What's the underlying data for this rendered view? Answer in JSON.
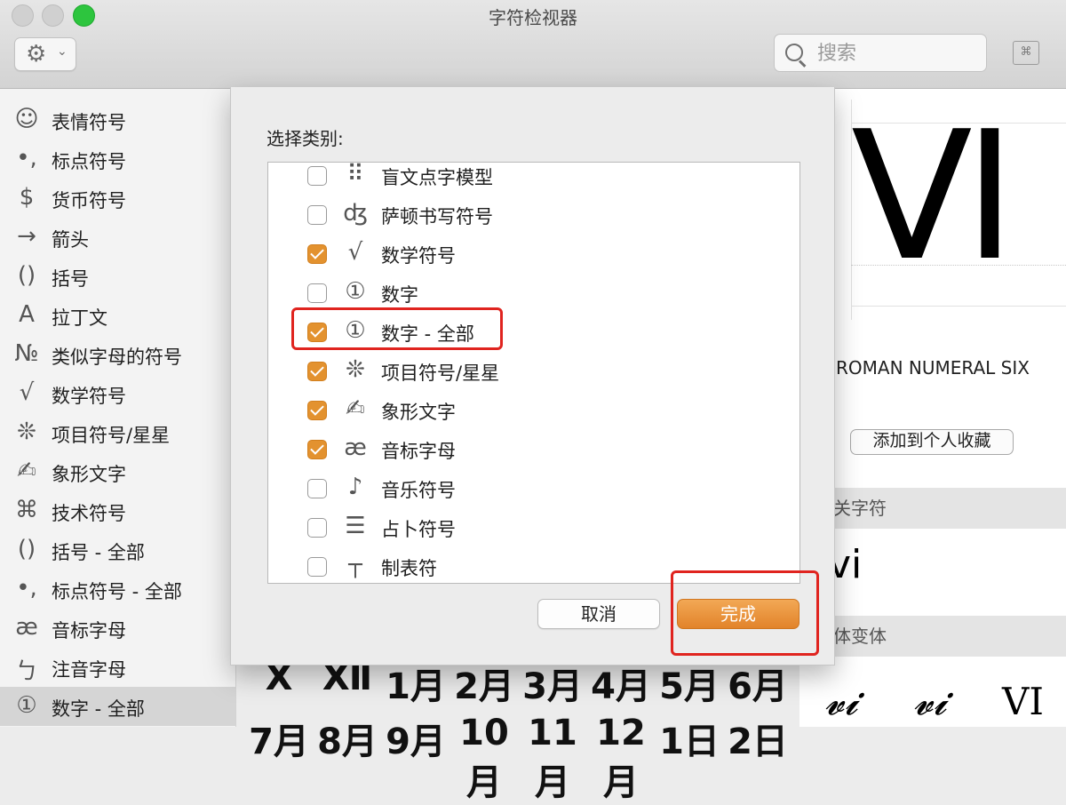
{
  "window": {
    "title": "字符检视器"
  },
  "toolbar": {
    "gear_icon": "⚙",
    "chevron": "⌄",
    "search_placeholder": "搜索",
    "keyboard_icon": "⌘"
  },
  "sidebar": {
    "items": [
      {
        "icon": "☺",
        "label": "表情符号"
      },
      {
        "icon": "•,",
        "label": "标点符号"
      },
      {
        "icon": "$",
        "label": "货币符号"
      },
      {
        "icon": "→",
        "label": "箭头"
      },
      {
        "icon": "()",
        "label": "括号"
      },
      {
        "icon": "A",
        "label": "拉丁文"
      },
      {
        "icon": "№",
        "label": "类似字母的符号"
      },
      {
        "icon": "√",
        "label": "数学符号"
      },
      {
        "icon": "❊",
        "label": "项目符号/星星"
      },
      {
        "icon": "✍",
        "label": "象形文字"
      },
      {
        "icon": "⌘",
        "label": "技术符号"
      },
      {
        "icon": "()",
        "label": "括号 - 全部"
      },
      {
        "icon": "•,",
        "label": "标点符号 - 全部"
      },
      {
        "icon": "æ",
        "label": "音标字母"
      },
      {
        "icon": "ㄅ",
        "label": "注音字母"
      },
      {
        "icon": "①",
        "label": "数字 - 全部"
      }
    ],
    "selected_index": 15
  },
  "dialog": {
    "label": "选择类别:",
    "categories": [
      {
        "icon": "⠿",
        "label": "盲文点字模型",
        "checked": false
      },
      {
        "icon": "ʤ",
        "label": "萨顿书写符号",
        "checked": false
      },
      {
        "icon": "√",
        "label": "数学符号",
        "checked": true
      },
      {
        "icon": "①",
        "label": "数字",
        "checked": false
      },
      {
        "icon": "①",
        "label": "数字 - 全部",
        "checked": true
      },
      {
        "icon": "❊",
        "label": "项目符号/星星",
        "checked": true
      },
      {
        "icon": "✍",
        "label": "象形文字",
        "checked": true
      },
      {
        "icon": "æ",
        "label": "音标字母",
        "checked": true
      },
      {
        "icon": "♪",
        "label": "音乐符号",
        "checked": false
      },
      {
        "icon": "☰",
        "label": "占卜符号",
        "checked": false
      },
      {
        "icon": "┬",
        "label": "制表符",
        "checked": false
      }
    ],
    "cancel_label": "取消",
    "done_label": "完成"
  },
  "detail": {
    "glyph": "VI",
    "name": "ROMAN NUMERAL SIX",
    "add_favorite_label": "添加到个人收藏",
    "related_header": "关字符",
    "related_char": "vi",
    "variants_header": "体变体",
    "variants": [
      "𝓿𝓲",
      "𝓿𝓲",
      "VI"
    ]
  },
  "grid": {
    "row1": [
      "X",
      "Ⅻ",
      "1月",
      "2月",
      "3月",
      "4月",
      "5月",
      "6月"
    ],
    "row2": [
      "7月",
      "8月",
      "9月",
      "10月",
      "11月",
      "12月",
      "1日",
      "2日"
    ]
  },
  "colors": {
    "accent": "#e3922f",
    "highlight": "#e0241f"
  }
}
